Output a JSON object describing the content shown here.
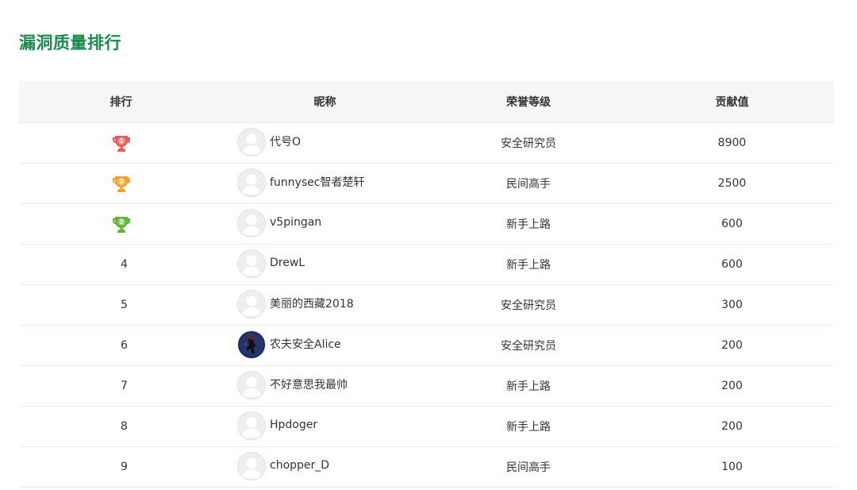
{
  "title": "漏洞质量排行",
  "headers": {
    "rank": "排行",
    "nickname": "昵称",
    "level": "荣誉等级",
    "score": "贡献值"
  },
  "colors": {
    "title": "#1a8a4f",
    "gold_trophy": "#e85a5a",
    "silver_trophy": "#f0a22b",
    "bronze_trophy": "#5fb435"
  },
  "rows": [
    {
      "rank": "1",
      "rank_icon": "trophy-red-icon",
      "nickname": "代号O",
      "avatar": "default-avatar-icon",
      "level": "安全研究员",
      "score": "8900"
    },
    {
      "rank": "2",
      "rank_icon": "trophy-orange-icon",
      "nickname": "funnysec智者楚轩",
      "avatar": "default-avatar-icon",
      "level": "民间高手",
      "score": "2500"
    },
    {
      "rank": "3",
      "rank_icon": "trophy-green-icon",
      "nickname": "v5pingan",
      "avatar": "default-avatar-icon",
      "level": "新手上路",
      "score": "600"
    },
    {
      "rank": "4",
      "nickname": "DrewL",
      "avatar": "default-avatar-icon",
      "level": "新手上路",
      "score": "600"
    },
    {
      "rank": "5",
      "nickname": "美丽的西藏2018",
      "avatar": "default-avatar-icon",
      "level": "安全研究员",
      "score": "300"
    },
    {
      "rank": "6",
      "nickname": "农夫安全Alice",
      "avatar": "photo-avatar-icon",
      "level": "安全研究员",
      "score": "200"
    },
    {
      "rank": "7",
      "nickname": "不好意思我最帅",
      "avatar": "default-avatar-icon",
      "level": "新手上路",
      "score": "200"
    },
    {
      "rank": "8",
      "nickname": "Hpdoger",
      "avatar": "default-avatar-icon",
      "level": "新手上路",
      "score": "200"
    },
    {
      "rank": "9",
      "nickname": "chopper_D",
      "avatar": "default-avatar-icon",
      "level": "民间高手",
      "score": "100"
    }
  ]
}
